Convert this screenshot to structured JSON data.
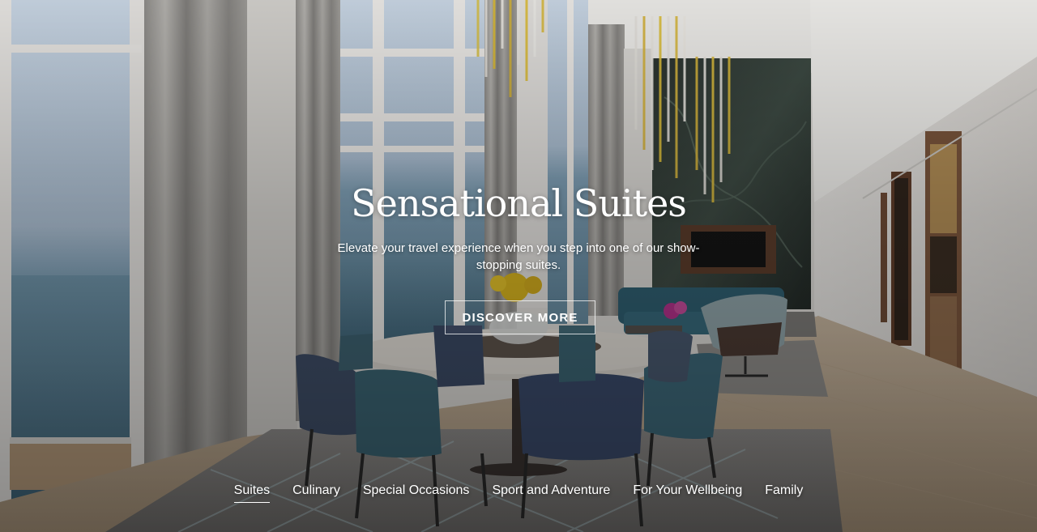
{
  "hero": {
    "title": "Sensational Suites",
    "subtitle": "Elevate your travel experience when you step into one of our show-stopping suites.",
    "cta_label": "DISCOVER MORE"
  },
  "category_nav": {
    "active_index": 0,
    "items": [
      {
        "label": "Suites"
      },
      {
        "label": "Culinary"
      },
      {
        "label": "Special Occasions"
      },
      {
        "label": "Sport and Adventure"
      },
      {
        "label": "For Your Wellbeing"
      },
      {
        "label": "Family"
      }
    ]
  }
}
